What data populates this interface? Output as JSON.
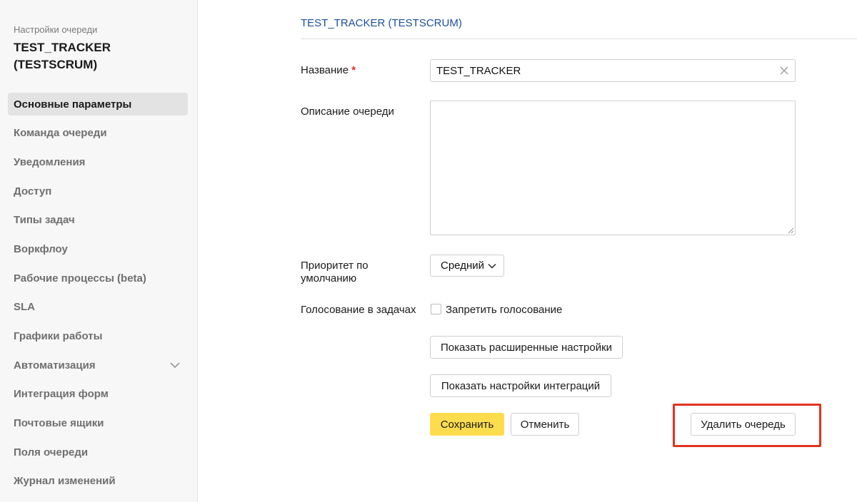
{
  "sidebar": {
    "caption": "Настройки очереди",
    "title": "TEST_TRACKER (TESTSCRUM)",
    "items": [
      {
        "label": "Основные параметры"
      },
      {
        "label": "Команда очереди"
      },
      {
        "label": "Уведомления"
      },
      {
        "label": "Доступ"
      },
      {
        "label": "Типы задач"
      },
      {
        "label": "Воркфлоу"
      },
      {
        "label": "Рабочие процессы (beta)"
      },
      {
        "label": "SLA"
      },
      {
        "label": "Графики работы"
      },
      {
        "label": "Автоматизация"
      },
      {
        "label": "Интеграция форм"
      },
      {
        "label": "Почтовые ящики"
      },
      {
        "label": "Поля очереди"
      },
      {
        "label": "Журнал изменений"
      }
    ],
    "active_index": 0,
    "expandable_item_icon": "chevron-down-icon"
  },
  "header": {
    "breadcrumb": "TEST_TRACKER (TESTSCRUM)"
  },
  "form": {
    "name": {
      "label": "Название",
      "required_mark": "*",
      "value": "TEST_TRACKER",
      "clear_icon": "close-icon"
    },
    "description": {
      "label": "Описание очереди",
      "value": ""
    },
    "priority": {
      "label": "Приоритет по умолчанию",
      "selected": "Средний"
    },
    "voting": {
      "label": "Голосование в задачах",
      "checkbox_label": "Запретить голосование",
      "checked": false
    },
    "advanced_button": "Показать расширенные настройки",
    "integrations_button": "Показать настройки интеграций",
    "save_button": "Сохранить",
    "cancel_button": "Отменить",
    "delete_button": "Удалить очередь"
  },
  "colors": {
    "accent_primary": "#fddd4e",
    "link": "#1a4f9c",
    "highlight": "#e0331e",
    "required": "#e52b2b"
  }
}
